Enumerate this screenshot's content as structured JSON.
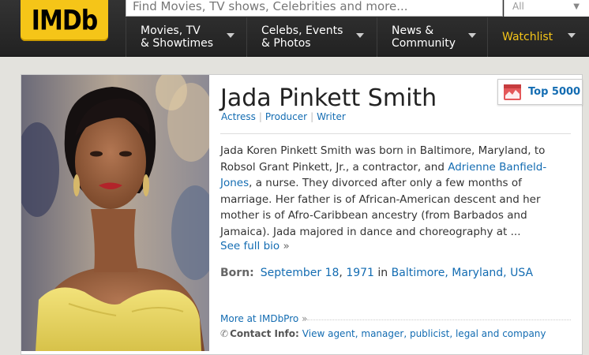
{
  "header": {
    "logo_text": "IMDb",
    "search_placeholder": "Find Movies, TV shows, Celebrities and more...",
    "search_scope": "All",
    "nav": [
      {
        "line1": "Movies, TV",
        "line2": "& Showtimes"
      },
      {
        "line1": "Celebs, Events",
        "line2": "& Photos"
      },
      {
        "line1": "News &",
        "line2": "Community"
      },
      {
        "line1": "Watchlist",
        "line2": ""
      }
    ]
  },
  "person": {
    "name": "Jada Pinkett Smith",
    "jobs": [
      "Actress",
      "Producer",
      "Writer"
    ],
    "bio_1": "Jada Koren Pinkett Smith was born in Baltimore, Maryland, to Robsol Grant Pinkett, Jr., a contractor, and ",
    "bio_link": "Adrienne Banfield-Jones",
    "bio_2": ", a nurse. They divorced after only a few months of marriage. Her father is of African-American descent and her mother is of Afro-Caribbean ancestry (from Barbados and Jamaica). Jada majored in dance and choreography at ...",
    "see_full_bio": "See full bio",
    "raquo": "»",
    "born_label": "Born:",
    "born_date": "September 18",
    "born_comma": ",",
    "born_year": "1971",
    "born_in": "in",
    "born_place": "Baltimore, Maryland, USA",
    "more_at": "More at IMDbPro",
    "contact_label": "Contact Info:",
    "contact_link": "View agent, manager, publicist, legal and company"
  },
  "meter": {
    "label": "Top 5000"
  },
  "colors": {
    "imdb_yellow": "#f5c518",
    "link_blue": "#136cb2",
    "nav_bg": "#222222"
  }
}
